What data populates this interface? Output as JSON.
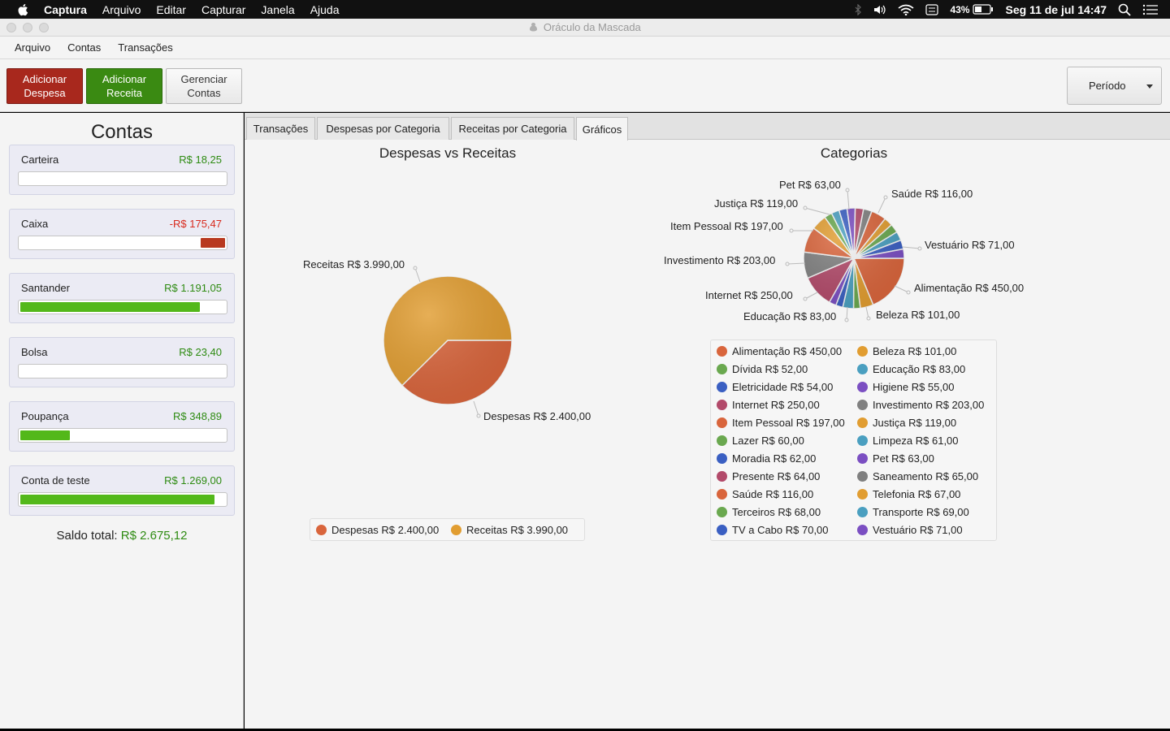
{
  "menubar": {
    "app": "Captura",
    "items": [
      "Arquivo",
      "Editar",
      "Capturar",
      "Janela",
      "Ajuda"
    ],
    "battery": "43%",
    "clock": "Seg 11 de jul  14:47"
  },
  "window": {
    "title": "Oráculo da Mascada"
  },
  "app_menu": [
    "Arquivo",
    "Contas",
    "Transações"
  ],
  "toolbar": {
    "add_expense": "Adicionar\nDespesa",
    "add_income": "Adicionar\nReceita",
    "manage_accounts": "Gerenciar\nContas",
    "period": "Período"
  },
  "accounts": {
    "heading": "Contas",
    "items": [
      {
        "name": "Carteira",
        "value": "R$ 18,25",
        "color": "#2e8b12",
        "fill": 0.0,
        "bar_color": "#53b81a"
      },
      {
        "name": "Caixa",
        "value": "-R$ 175,47",
        "color": "#d8291c",
        "fill": 0.12,
        "bar_color": "#b8391f"
      },
      {
        "name": "Santander",
        "value": "R$ 1.191,05",
        "color": "#2e8b12",
        "fill": 0.87,
        "bar_color": "#53b81a"
      },
      {
        "name": "Bolsa",
        "value": "R$ 23,40",
        "color": "#2e8b12",
        "fill": 0.0,
        "bar_color": "#53b81a"
      },
      {
        "name": "Poupança",
        "value": "R$ 348,89",
        "color": "#2e8b12",
        "fill": 0.24,
        "bar_color": "#53b81a"
      },
      {
        "name": "Conta de teste",
        "value": "R$ 1.269,00",
        "color": "#2e8b12",
        "fill": 0.94,
        "bar_color": "#53b81a"
      }
    ],
    "total_label": "Saldo total:",
    "total_value": "R$ 2.675,12"
  },
  "tabs": [
    "Transações",
    "Despesas por Categoria",
    "Receitas por Categoria",
    "Gráficos"
  ],
  "active_tab": 3,
  "chart_data": [
    {
      "type": "pie",
      "title": "Despesas vs Receitas",
      "labels": [
        "Despesas R$ 2.400,00",
        "Receitas R$ 3.990,00"
      ],
      "values": [
        2400,
        3990
      ],
      "colors": [
        "#d9653c",
        "#e19d31"
      ],
      "legend": [
        "Despesas R$ 2.400,00",
        "Receitas R$ 3.990,00"
      ]
    },
    {
      "type": "pie",
      "title": "Categorias",
      "labels": [
        "Alimentação R$ 450,00",
        "Beleza R$ 101,00",
        "Dívida R$ 52,00",
        "Educação R$ 83,00",
        "Eletricidade R$ 54,00",
        "Higiene R$ 55,00",
        "Internet R$ 250,00",
        "Investimento R$ 203,00",
        "Item Pessoal R$ 197,00",
        "Justiça R$ 119,00",
        "Lazer R$ 60,00",
        "Limpeza R$ 61,00",
        "Moradia R$ 62,00",
        "Pet R$ 63,00",
        "Presente R$ 64,00",
        "Saneamento R$ 65,00",
        "Saúde R$ 116,00",
        "Telefonia R$ 67,00",
        "Terceiros R$ 68,00",
        "Transporte R$ 69,00",
        "TV a Cabo R$ 70,00",
        "Vestuário R$ 71,00"
      ],
      "values": [
        450,
        101,
        52,
        83,
        54,
        55,
        250,
        203,
        197,
        119,
        60,
        61,
        62,
        63,
        64,
        65,
        116,
        67,
        68,
        69,
        70,
        71
      ],
      "colors": [
        "#d9653c",
        "#e19d31",
        "#6aa84f",
        "#4a9fc0",
        "#3a5fc2",
        "#7b4fc2",
        "#b24a6a",
        "#808080",
        "#d9653c",
        "#e19d31",
        "#6aa84f",
        "#4a9fc0",
        "#3a5fc2",
        "#7b4fc2",
        "#b24a6a",
        "#808080",
        "#d9653c",
        "#e19d31",
        "#6aa84f",
        "#4a9fc0",
        "#3a5fc2",
        "#7b4fc2"
      ],
      "slice_labels": [
        "Pet R$ 63,00",
        "Saúde R$ 116,00",
        "Justiça R$ 119,00",
        "Item Pessoal R$ 197,00",
        "Vestuário R$ 71,00",
        "Investimento R$ 203,00",
        "Alimentação R$ 450,00",
        "Internet R$ 250,00",
        "Beleza R$ 101,00",
        "Educação R$ 83,00"
      ]
    }
  ]
}
